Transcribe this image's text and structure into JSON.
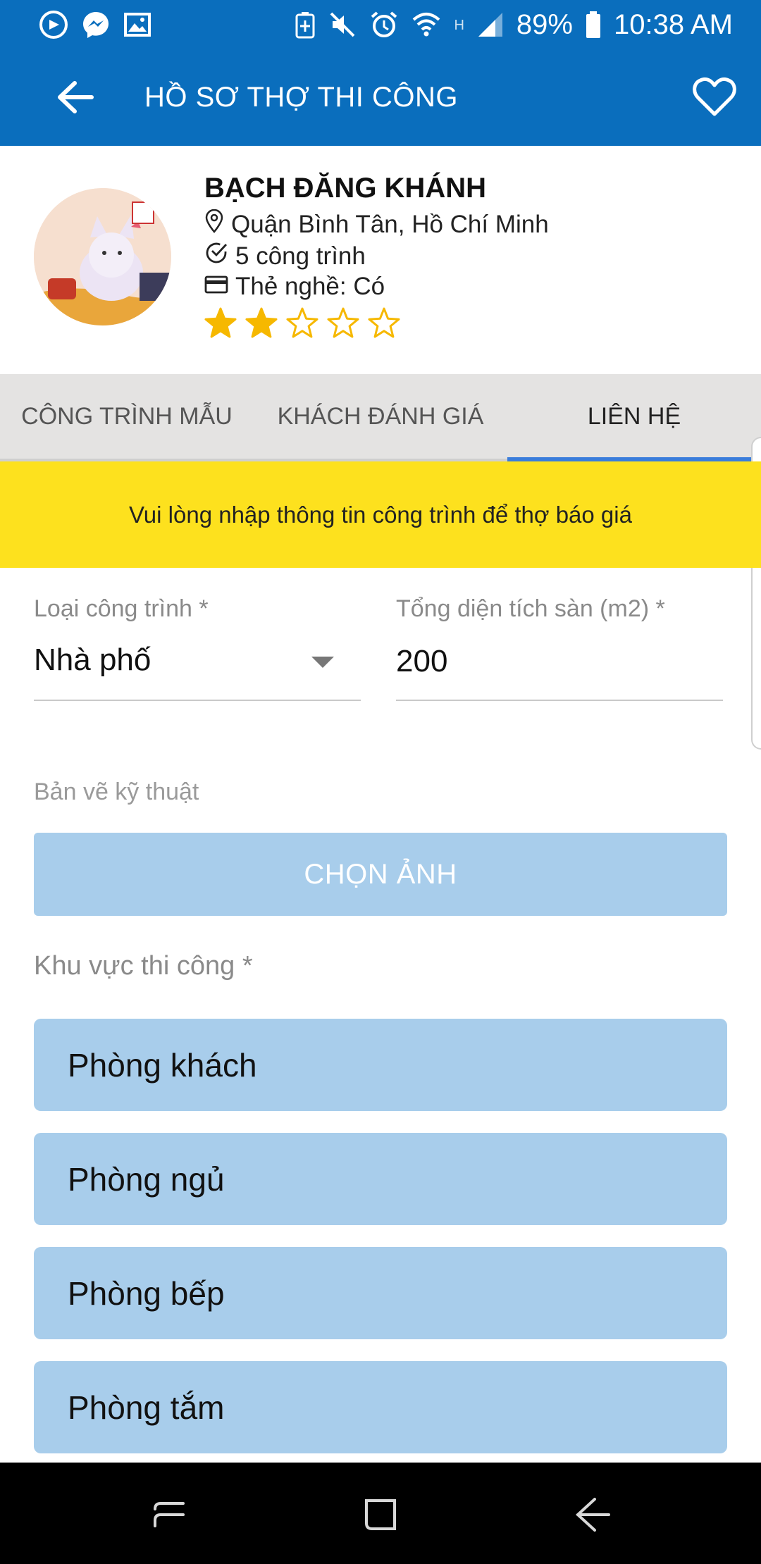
{
  "status_bar": {
    "battery": "89%",
    "time": "10:38 AM",
    "network": "H",
    "left_icons": [
      "messenger-app-icon",
      "messenger-icon",
      "gallery-icon"
    ],
    "right_icons": [
      "battery-saver-icon",
      "mute-icon",
      "alarm-icon",
      "wifi-icon",
      "signal-icon",
      "battery-icon"
    ]
  },
  "app_bar": {
    "title": "HỒ SƠ THỢ THI CÔNG",
    "back_icon": "arrow-left-icon",
    "favorite_icon": "heart-outline-icon"
  },
  "profile": {
    "name": "BẠCH ĐĂNG KHÁNH",
    "location": "Quận Bình Tân, Hồ Chí Minh",
    "projects": "5 công trình",
    "license": "Thẻ nghề: Có",
    "rating": 2,
    "rating_max": 5,
    "star_color": "#f6b800"
  },
  "tabs": [
    {
      "label": "CÔNG TRÌNH MẪU",
      "active": false
    },
    {
      "label": "KHÁCH ĐÁNH GIÁ",
      "active": false
    },
    {
      "label": "LIÊN HỆ",
      "active": true
    }
  ],
  "banner": {
    "text": "Vui lòng nhập thông tin công trình để thợ báo giá",
    "color": "#fde11e"
  },
  "form": {
    "project_type": {
      "label": "Loại công trình *",
      "value": "Nhà phố"
    },
    "floor_area": {
      "label": "Tổng diện tích sàn (m2) *",
      "value": "200"
    },
    "drawings": {
      "label": "Bản vẽ kỹ thuật",
      "button": "CHỌN ẢNH"
    },
    "areas": {
      "label": "Khu vực thi công *",
      "items": [
        "Phòng khách",
        "Phòng ngủ",
        "Phòng bếp",
        "Phòng tắm"
      ]
    }
  },
  "nav_bar": {
    "buttons": [
      "recents-icon",
      "home-icon",
      "back-icon"
    ]
  },
  "colors": {
    "primary": "#0a6ebd",
    "tab_indicator": "#3a7ddb",
    "button_bg": "#a8cdeb"
  }
}
